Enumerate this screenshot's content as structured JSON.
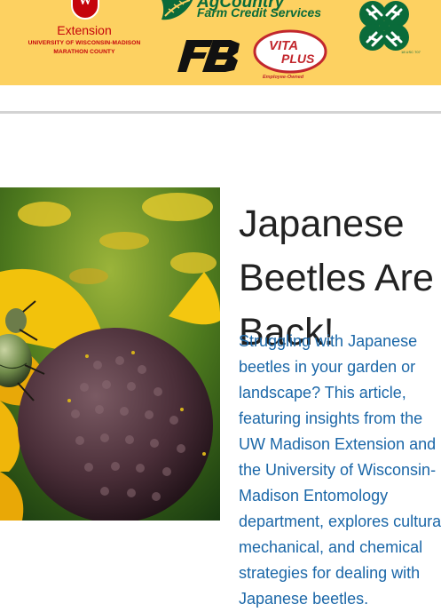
{
  "sponsors": {
    "extension": {
      "crest_letter": "W",
      "name": "Extension",
      "line1": "UNIVERSITY OF WISCONSIN-MADISON",
      "line2": "MARATHON COUNTY"
    },
    "agcountry": {
      "name": "AgCountry",
      "tagline": "Farm Credit Services"
    },
    "farm_bureau": {
      "mark": "FB"
    },
    "vita_plus": {
      "word1": "VITA",
      "word2": "PLUS",
      "caption": "Employee-Owned"
    },
    "four_h": {
      "caption": "18 USC 707"
    }
  },
  "article": {
    "title": "Japanese Beetles Are Back!",
    "summary": "Struggling with Japanese beetles in your garden or landscape? This article, featuring insights from the UW Madison Extension and the University of Wisconsin-Madison Entomology department, explores cultural, mechanical, and chemical strategies for dealing with Japanese beetles.",
    "image_alt": "Japanese beetle on a black-eyed Susan flower"
  },
  "colors": {
    "banner": "#fdd161",
    "uw_red": "#c5050c",
    "agcountry_green": "#0a6b3a",
    "link_blue": "#1b67a8",
    "title": "#222222"
  }
}
